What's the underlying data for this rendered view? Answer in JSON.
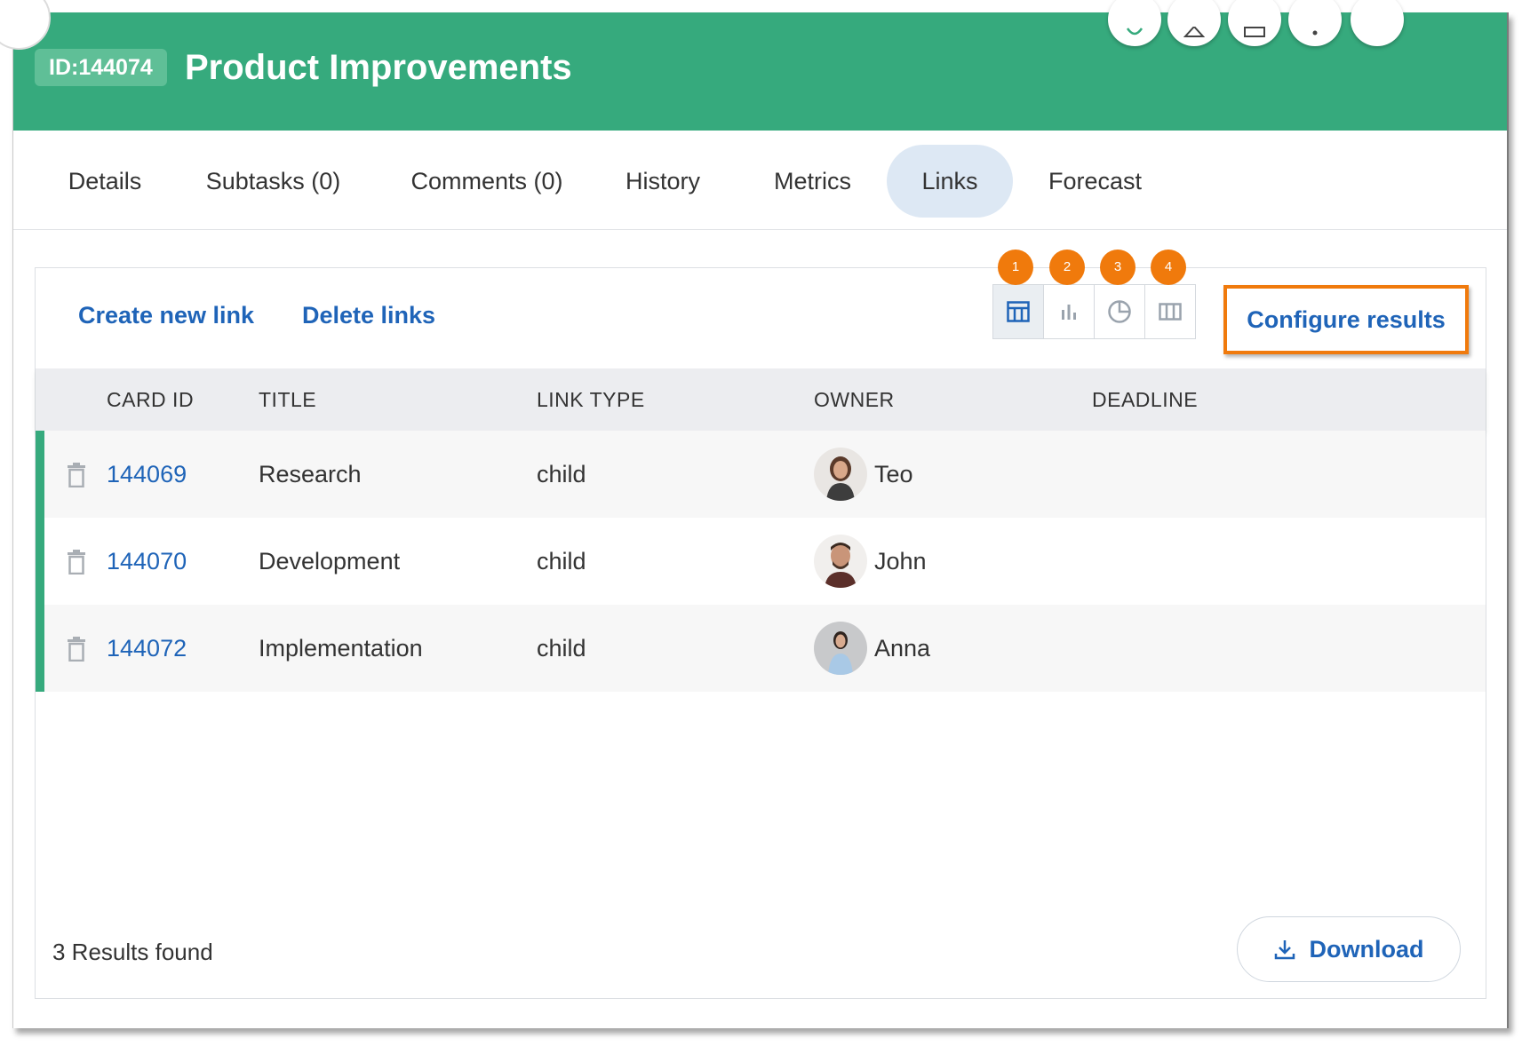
{
  "header": {
    "id_badge": "ID:144074",
    "title": "Product Improvements",
    "bg_color": "#36aa7d"
  },
  "tabs": [
    {
      "label": "Details"
    },
    {
      "label": "Subtasks (0)"
    },
    {
      "label": "Comments (0)"
    },
    {
      "label": "History"
    },
    {
      "label": "Metrics"
    },
    {
      "label": "Links",
      "active": true
    },
    {
      "label": "Forecast"
    }
  ],
  "toolbar": {
    "create_link": "Create new link",
    "delete_links": "Delete links",
    "configure_results": "Configure results",
    "view_modes": [
      {
        "badge": "1",
        "icon": "table-icon",
        "active": true
      },
      {
        "badge": "2",
        "icon": "bar-chart-icon"
      },
      {
        "badge": "3",
        "icon": "pie-chart-icon"
      },
      {
        "badge": "4",
        "icon": "columns-icon"
      }
    ],
    "highlight_color": "#f07a0c"
  },
  "table": {
    "columns": [
      "CARD ID",
      "TITLE",
      "LINK TYPE",
      "OWNER",
      "DEADLINE"
    ],
    "rows": [
      {
        "card_id": "144069",
        "title": "Research",
        "link_type": "child",
        "owner": "Teo",
        "deadline": ""
      },
      {
        "card_id": "144070",
        "title": "Development",
        "link_type": "child",
        "owner": "John",
        "deadline": ""
      },
      {
        "card_id": "144072",
        "title": "Implementation",
        "link_type": "child",
        "owner": "Anna",
        "deadline": ""
      }
    ]
  },
  "footer": {
    "results_text": "3 Results found",
    "download_label": "Download"
  }
}
